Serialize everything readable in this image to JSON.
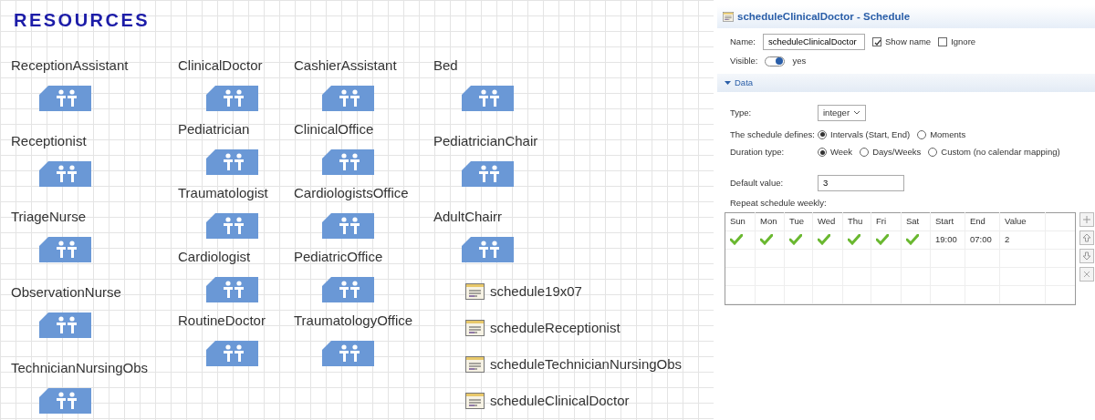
{
  "canvas": {
    "title": "RESOURCES",
    "columns": [
      {
        "items": [
          {
            "kind": "resource",
            "label": "ReceptionAssistant"
          },
          {
            "kind": "resource",
            "label": "Receptionist"
          },
          {
            "kind": "resource",
            "label": "TriageNurse"
          },
          {
            "kind": "resource",
            "label": "ObservationNurse"
          },
          {
            "kind": "resource",
            "label": "TechnicianNursingObs"
          }
        ]
      },
      {
        "items": [
          {
            "kind": "resource",
            "label": "ClinicalDoctor"
          },
          {
            "kind": "resource",
            "label": "Pediatrician"
          },
          {
            "kind": "resource",
            "label": "Traumatologist"
          },
          {
            "kind": "resource",
            "label": "Cardiologist"
          },
          {
            "kind": "resource",
            "label": "RoutineDoctor"
          }
        ]
      },
      {
        "items": [
          {
            "kind": "resource",
            "label": "CashierAssistant"
          },
          {
            "kind": "resource",
            "label": "ClinicalOffice"
          },
          {
            "kind": "resource",
            "label": "CardiologistsOffice"
          },
          {
            "kind": "resource",
            "label": "PediatricOffice"
          },
          {
            "kind": "resource",
            "label": "TraumatologyOffice"
          }
        ]
      },
      {
        "items": [
          {
            "kind": "resource",
            "label": "Bed"
          },
          {
            "kind": "resource",
            "label": "PediatricianChair"
          },
          {
            "kind": "resource",
            "label": "AdultChairr"
          },
          {
            "kind": "schedule",
            "label": "schedule19x07"
          },
          {
            "kind": "schedule",
            "label": "scheduleReceptionist"
          },
          {
            "kind": "schedule",
            "label": "scheduleTechnicianNursingObs"
          },
          {
            "kind": "schedule",
            "label": "scheduleClinicalDoctor"
          }
        ]
      }
    ]
  },
  "panel": {
    "title": "scheduleClinicalDoctor - Schedule",
    "name": {
      "label": "Name:",
      "value": "scheduleClinicalDoctor"
    },
    "checkboxes": [
      {
        "label": "Show name",
        "checked": true
      },
      {
        "label": "Ignore",
        "checked": false
      }
    ],
    "visible": {
      "label": "Visible:",
      "on": true,
      "text": "yes"
    },
    "section": {
      "label": "Data",
      "expanded": true
    },
    "type": {
      "label": "Type:",
      "value": "integer"
    },
    "radio_groups": [
      {
        "label": "The schedule defines:",
        "options": [
          {
            "label": "Intervals (Start, End)",
            "selected": true
          },
          {
            "label": "Moments",
            "selected": false
          }
        ]
      },
      {
        "label": "Duration type:",
        "options": [
          {
            "label": "Week",
            "selected": true
          },
          {
            "label": "Days/Weeks",
            "selected": false
          },
          {
            "label": "Custom (no calendar mapping)",
            "selected": false
          }
        ]
      }
    ],
    "default_value": {
      "label": "Default value:",
      "value": "3"
    },
    "repeat_label": "Repeat schedule weekly:",
    "table": {
      "columns": [
        "Sun",
        "Mon",
        "Tue",
        "Wed",
        "Thu",
        "Fri",
        "Sat",
        "Start",
        "End",
        "Value"
      ],
      "rows": [
        {
          "days": [
            {
              "checked": true
            },
            {
              "checked": true
            },
            {
              "checked": true
            },
            {
              "checked": true
            },
            {
              "checked": true
            },
            {
              "checked": true
            },
            {
              "checked": true
            }
          ],
          "start": "19:00",
          "end": "07:00",
          "value": "2"
        }
      ]
    }
  }
}
